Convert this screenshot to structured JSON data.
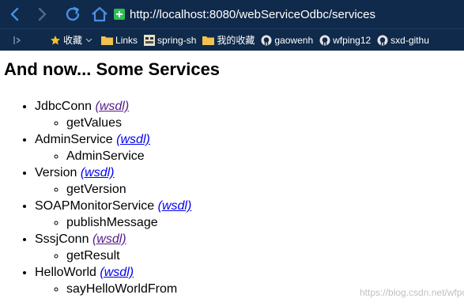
{
  "browser": {
    "url": "http://localhost:8080/webServiceOdbc/services"
  },
  "bookmarks": [
    {
      "label": "收藏",
      "icon": "star-icon"
    },
    {
      "label": "Links",
      "icon": "folder-icon"
    },
    {
      "label": "spring-sh",
      "icon": "site-icon"
    },
    {
      "label": "我的收藏",
      "icon": "folder-icon"
    },
    {
      "label": "gaowenh",
      "icon": "github-icon"
    },
    {
      "label": "wfping12",
      "icon": "github-icon"
    },
    {
      "label": "sxd-githu",
      "icon": "github-icon"
    }
  ],
  "page": {
    "heading": "And now... Some Services",
    "wsdl_label": "(wsdl)",
    "services": [
      {
        "name": "JdbcConn",
        "operations": [
          "getValues"
        ],
        "visited": true
      },
      {
        "name": "AdminService",
        "operations": [
          "AdminService"
        ],
        "visited": false
      },
      {
        "name": "Version",
        "operations": [
          "getVersion"
        ],
        "visited": false
      },
      {
        "name": "SOAPMonitorService",
        "operations": [
          "publishMessage"
        ],
        "visited": false
      },
      {
        "name": "SssjConn",
        "operations": [
          "getResult"
        ],
        "visited": true
      },
      {
        "name": "HelloWorld",
        "operations": [
          "sayHelloWorldFrom"
        ],
        "visited": false
      }
    ]
  },
  "watermark": "https://blog.csdn.net/wfpc...",
  "colors": {
    "chrome": "#0f2a4a",
    "icon_blue": "#4a8fe7",
    "link_visited": "#551a8b",
    "link_unvisited": "#0000ee"
  }
}
